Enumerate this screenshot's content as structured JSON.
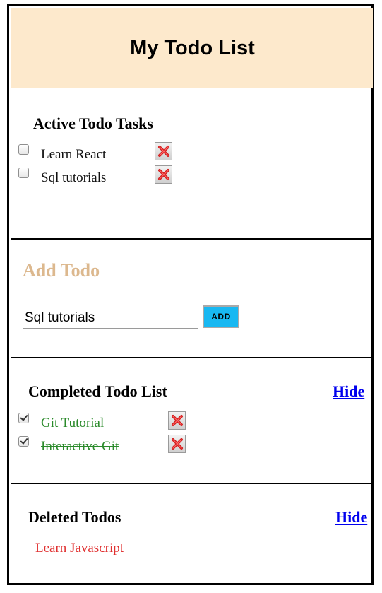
{
  "header": {
    "title": "My Todo List"
  },
  "active": {
    "title": "Active Todo Tasks",
    "items": [
      {
        "label": "Learn React",
        "checked": false
      },
      {
        "label": "Sql tutorials",
        "checked": false
      }
    ]
  },
  "add": {
    "title": "Add Todo",
    "input_value": "Sql tutorials",
    "button_label": "ADD"
  },
  "completed": {
    "title": "Completed Todo List",
    "hide_label": "Hide",
    "items": [
      {
        "label": "Git Tutorial",
        "checked": true
      },
      {
        "label": "Interactive Git",
        "checked": true
      }
    ]
  },
  "deleted": {
    "title": "Deleted Todos",
    "hide_label": "Hide",
    "items": [
      {
        "label": "Learn Javascript"
      }
    ]
  },
  "colors": {
    "header_bg": "#fde9cc",
    "add_title": "#dcb88e",
    "add_button": "#18b8f2",
    "completed_text": "#2a8a2a",
    "deleted_text": "#e03030",
    "link": "#0000ee"
  }
}
